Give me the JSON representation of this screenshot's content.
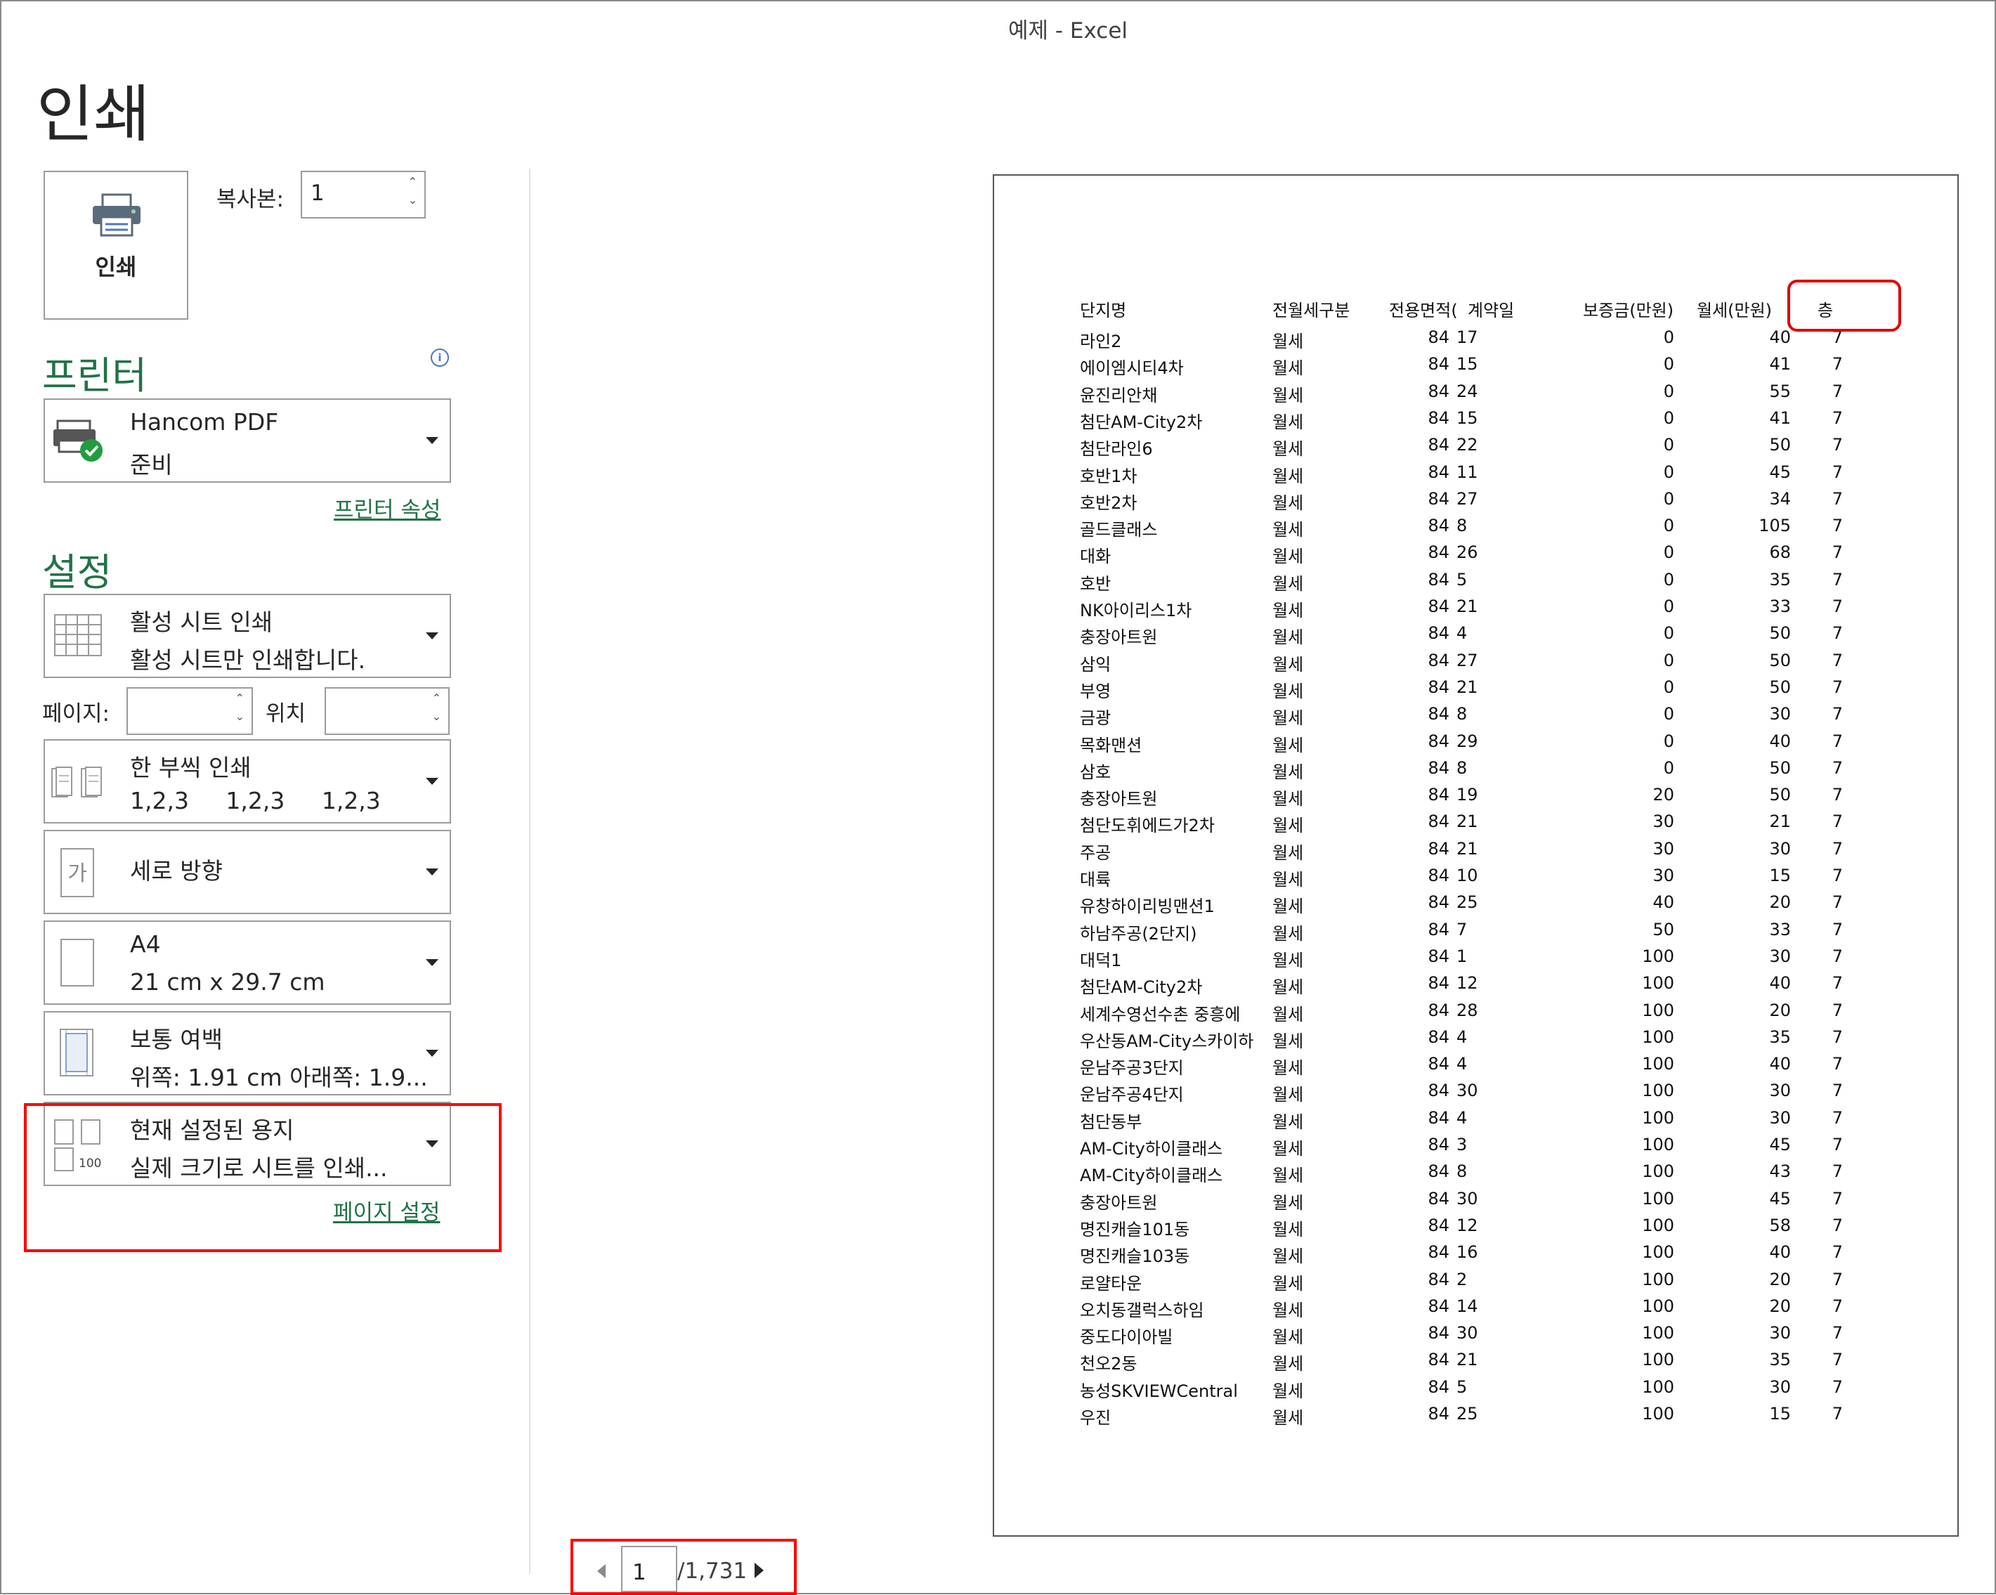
{
  "window": {
    "title": "예제  -  Excel"
  },
  "page_title": "인쇄",
  "print_button": {
    "label": "인쇄"
  },
  "copies": {
    "label": "복사본:",
    "value": "1"
  },
  "printer": {
    "heading": "프린터",
    "name": "Hancom PDF",
    "status": "준비",
    "properties_link": "프린터 속성"
  },
  "settings": {
    "heading": "설정",
    "scope": {
      "title": "활성 시트 인쇄",
      "desc": "활성 시트만 인쇄합니다."
    },
    "pages_label": "페이지:",
    "pages_value": "",
    "to_label": "위치",
    "to_value": "",
    "collate": {
      "title": "한 부씩 인쇄",
      "desc": "1,2,3     1,2,3     1,2,3"
    },
    "orientation": {
      "title": "세로 방향",
      "icon_text": "가"
    },
    "paper": {
      "title": "A4",
      "desc": "21 cm x 29.7 cm"
    },
    "margins": {
      "title": "보통 여백",
      "desc": "위쪽: 1.91 cm 아래쪽: 1.9..."
    },
    "scaling": {
      "title": "현재 설정된 용지",
      "desc": "실제 크기로 시트를 인쇄...",
      "icon_text": "100"
    },
    "page_setup_link": "페이지 설정"
  },
  "navigation": {
    "current_page": "1",
    "total": "/1,731"
  },
  "preview": {
    "headers": [
      "단지명",
      "전월세구분",
      "전용면적(",
      "계약일",
      "보증금(만원)",
      "월세(만원)",
      "층"
    ],
    "rows": [
      [
        "라인2",
        "월세",
        "84",
        "17",
        "0",
        "40",
        "7"
      ],
      [
        "에이엠시티4차",
        "월세",
        "84",
        "15",
        "0",
        "41",
        "7"
      ],
      [
        "윤진리안채",
        "월세",
        "84",
        "24",
        "0",
        "55",
        "7"
      ],
      [
        "첨단AM-City2차",
        "월세",
        "84",
        "15",
        "0",
        "41",
        "7"
      ],
      [
        "첨단라인6",
        "월세",
        "84",
        "22",
        "0",
        "50",
        "7"
      ],
      [
        "호반1차",
        "월세",
        "84",
        "11",
        "0",
        "45",
        "7"
      ],
      [
        "호반2차",
        "월세",
        "84",
        "27",
        "0",
        "34",
        "7"
      ],
      [
        "골드클래스",
        "월세",
        "84",
        "8",
        "0",
        "105",
        "7"
      ],
      [
        "대화",
        "월세",
        "84",
        "26",
        "0",
        "68",
        "7"
      ],
      [
        "호반",
        "월세",
        "84",
        "5",
        "0",
        "35",
        "7"
      ],
      [
        "NK아이리스1차",
        "월세",
        "84",
        "21",
        "0",
        "33",
        "7"
      ],
      [
        "충장아트원",
        "월세",
        "84",
        "4",
        "0",
        "50",
        "7"
      ],
      [
        "삼익",
        "월세",
        "84",
        "27",
        "0",
        "50",
        "7"
      ],
      [
        "부영",
        "월세",
        "84",
        "21",
        "0",
        "50",
        "7"
      ],
      [
        "금광",
        "월세",
        "84",
        "8",
        "0",
        "30",
        "7"
      ],
      [
        "목화맨션",
        "월세",
        "84",
        "29",
        "0",
        "40",
        "7"
      ],
      [
        "삼호",
        "월세",
        "84",
        "8",
        "0",
        "50",
        "7"
      ],
      [
        "충장아트원",
        "월세",
        "84",
        "19",
        "20",
        "50",
        "7"
      ],
      [
        "첨단도휘에드가2차",
        "월세",
        "84",
        "21",
        "30",
        "21",
        "7"
      ],
      [
        "주공",
        "월세",
        "84",
        "21",
        "30",
        "30",
        "7"
      ],
      [
        "대륙",
        "월세",
        "84",
        "10",
        "30",
        "15",
        "7"
      ],
      [
        "유창하이리빙맨션1",
        "월세",
        "84",
        "25",
        "40",
        "20",
        "7"
      ],
      [
        "하남주공(2단지)",
        "월세",
        "84",
        "7",
        "50",
        "33",
        "7"
      ],
      [
        "대덕1",
        "월세",
        "84",
        "1",
        "100",
        "30",
        "7"
      ],
      [
        "첨단AM-City2차",
        "월세",
        "84",
        "12",
        "100",
        "40",
        "7"
      ],
      [
        "세계수영선수촌 중흥에",
        "월세",
        "84",
        "28",
        "100",
        "20",
        "7"
      ],
      [
        "우산동AM-City스카이하",
        "월세",
        "84",
        "4",
        "100",
        "35",
        "7"
      ],
      [
        "운남주공3단지",
        "월세",
        "84",
        "4",
        "100",
        "40",
        "7"
      ],
      [
        "운남주공4단지",
        "월세",
        "84",
        "30",
        "100",
        "30",
        "7"
      ],
      [
        "첨단동부",
        "월세",
        "84",
        "4",
        "100",
        "30",
        "7"
      ],
      [
        "AM-City하이클래스",
        "월세",
        "84",
        "3",
        "100",
        "45",
        "7"
      ],
      [
        "AM-City하이클래스",
        "월세",
        "84",
        "8",
        "100",
        "43",
        "7"
      ],
      [
        "충장아트원",
        "월세",
        "84",
        "30",
        "100",
        "45",
        "7"
      ],
      [
        "명진캐슬101동",
        "월세",
        "84",
        "12",
        "100",
        "58",
        "7"
      ],
      [
        "명진캐슬103동",
        "월세",
        "84",
        "16",
        "100",
        "40",
        "7"
      ],
      [
        "로얄타운",
        "월세",
        "84",
        "2",
        "100",
        "20",
        "7"
      ],
      [
        "오치동갤럭스하임",
        "월세",
        "84",
        "14",
        "100",
        "20",
        "7"
      ],
      [
        "중도다이아빌",
        "월세",
        "84",
        "30",
        "100",
        "30",
        "7"
      ],
      [
        "천오2동",
        "월세",
        "84",
        "21",
        "100",
        "35",
        "7"
      ],
      [
        "농성SKVIEWCentral",
        "월세",
        "84",
        "5",
        "100",
        "30",
        "7"
      ],
      [
        "우진",
        "월세",
        "84",
        "25",
        "100",
        "15",
        "7"
      ]
    ]
  }
}
